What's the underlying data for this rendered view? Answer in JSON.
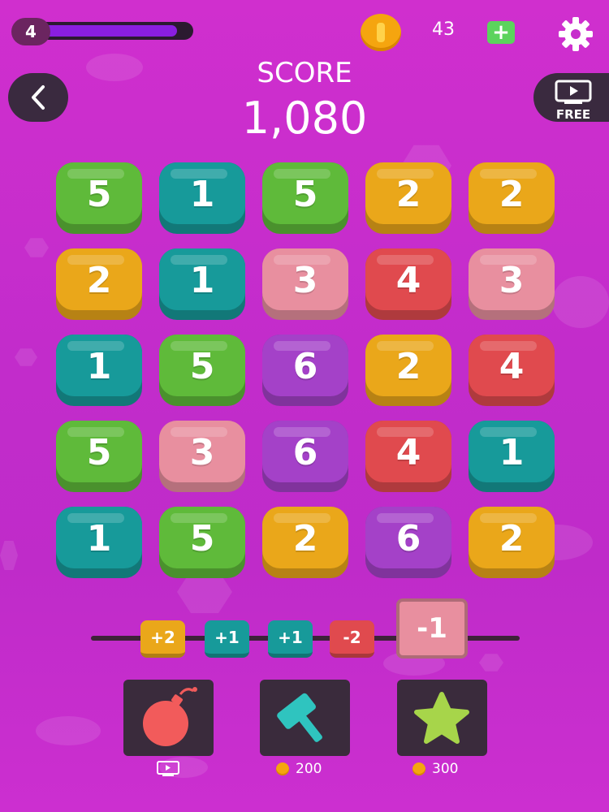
{
  "top_bar": {
    "level": "4",
    "level_progress": 0.92,
    "coin_count": "43",
    "add_coins_label": "+"
  },
  "score": {
    "label": "SCORE",
    "value": "1,080"
  },
  "free_button": {
    "label": "FREE"
  },
  "colors": {
    "green": "#5fba3a",
    "teal": "#179a9a",
    "yellow": "#eaa71a",
    "pink": "#e88f9f",
    "red": "#e04a4e",
    "purple": "#a441c8"
  },
  "board": {
    "rows": [
      [
        {
          "value": "5",
          "color": "green"
        },
        {
          "value": "1",
          "color": "teal"
        },
        {
          "value": "5",
          "color": "green"
        },
        {
          "value": "2",
          "color": "yellow"
        },
        {
          "value": "2",
          "color": "yellow"
        }
      ],
      [
        {
          "value": "2",
          "color": "yellow"
        },
        {
          "value": "1",
          "color": "teal"
        },
        {
          "value": "3",
          "color": "pink"
        },
        {
          "value": "4",
          "color": "red"
        },
        {
          "value": "3",
          "color": "pink"
        }
      ],
      [
        {
          "value": "1",
          "color": "teal"
        },
        {
          "value": "5",
          "color": "green"
        },
        {
          "value": "6",
          "color": "purple"
        },
        {
          "value": "2",
          "color": "yellow"
        },
        {
          "value": "4",
          "color": "red"
        }
      ],
      [
        {
          "value": "5",
          "color": "green"
        },
        {
          "value": "3",
          "color": "pink"
        },
        {
          "value": "6",
          "color": "purple"
        },
        {
          "value": "4",
          "color": "red"
        },
        {
          "value": "1",
          "color": "teal"
        }
      ],
      [
        {
          "value": "1",
          "color": "teal"
        },
        {
          "value": "5",
          "color": "green"
        },
        {
          "value": "2",
          "color": "yellow"
        },
        {
          "value": "6",
          "color": "purple"
        },
        {
          "value": "2",
          "color": "yellow"
        }
      ]
    ]
  },
  "queue": [
    {
      "label": "+2",
      "color": "yellow"
    },
    {
      "label": "+1",
      "color": "teal"
    },
    {
      "label": "+1",
      "color": "teal"
    },
    {
      "label": "-2",
      "color": "red"
    },
    {
      "label": "-1",
      "color": "pink",
      "current": true
    }
  ],
  "boosters": [
    {
      "name": "bomb",
      "icon": "bomb-icon",
      "cost": "",
      "cost_icon": "video-ad-icon"
    },
    {
      "name": "hammer",
      "icon": "hammer-icon",
      "cost": "200",
      "cost_icon": "coin-icon"
    },
    {
      "name": "star",
      "icon": "star-icon",
      "cost": "300",
      "cost_icon": "coin-icon"
    }
  ]
}
